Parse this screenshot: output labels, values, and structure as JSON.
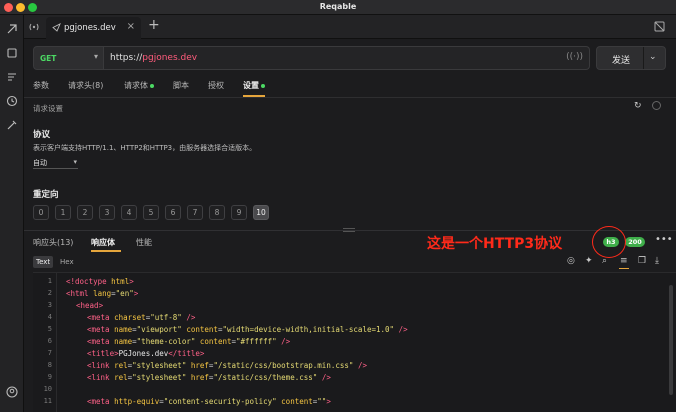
{
  "window": {
    "title": "Reqable"
  },
  "tabs": [
    {
      "label": "pgjones.dev"
    }
  ],
  "request": {
    "method": "GET",
    "url_scheme": "https://",
    "url_host": "pgjones.dev",
    "send_label": "发送"
  },
  "request_tabs": [
    {
      "label": "参数"
    },
    {
      "label": "请求头(8)"
    },
    {
      "label": "请求体"
    },
    {
      "label": "脚本"
    },
    {
      "label": "授权"
    },
    {
      "label": "设置"
    }
  ],
  "settings": {
    "subtitle": "请求设置",
    "protocol_title": "协议",
    "protocol_desc": "表示客户端支持HTTP/1.1、HTTP2和HTTP3，由服务器选择合适版本。",
    "protocol_value": "自动",
    "redirect_title": "重定向",
    "redirect_options": [
      "0",
      "1",
      "2",
      "3",
      "4",
      "5",
      "6",
      "7",
      "8",
      "9",
      "10"
    ],
    "redirect_selected": "10"
  },
  "response_tabs": [
    {
      "label": "响应头(13)"
    },
    {
      "label": "响应体"
    },
    {
      "label": "性能"
    }
  ],
  "annotation": "这是一个HTTP3协议",
  "badges": {
    "protocol": "h3",
    "status": "200"
  },
  "body_modes": [
    "Text",
    "Hex"
  ],
  "code": {
    "line_numbers": [
      "1",
      "2",
      "3",
      "4",
      "5",
      "6",
      "7",
      "8",
      "9",
      "10",
      "11"
    ]
  },
  "colors": {
    "accent": "#e5a53c",
    "method": "#4cd964",
    "annotation": "#ff2a1a",
    "status_badge": "#3fae4a"
  }
}
